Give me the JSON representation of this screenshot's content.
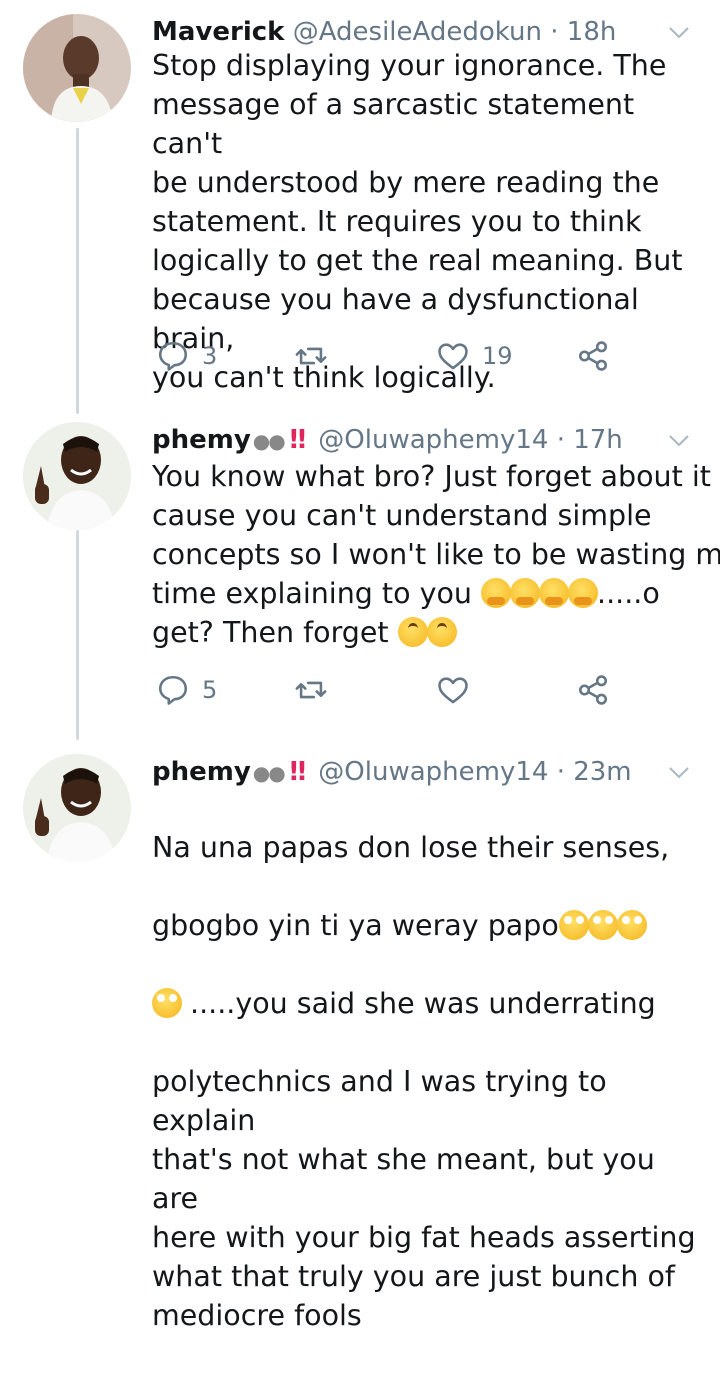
{
  "colors": {
    "text": "#14171a",
    "muted": "#657786",
    "accent_bang": "#e0245e",
    "thread_line": "#cfd9de"
  },
  "tweets": [
    {
      "display_name": "Maverick",
      "handle": "@AdesileAdedokun",
      "time": "18h",
      "text": "Stop displaying your ignorance. The\nmessage of a sarcastic statement can't\nbe understood by mere reading the\nstatement. It requires you to think\nlogically to get the real meaning. But\nbecause you have a dysfunctional brain,\nyou can't think logically.",
      "replies": "3",
      "likes": "19"
    },
    {
      "display_name": "phemy",
      "handle": "@Oluwaphemy14",
      "time": "17h",
      "text_line1": "You know what bro? Just forget about it",
      "text_line2": "cause you can't understand simple",
      "text_line3": "concepts so I won't like to be wasting my",
      "text_line4_a": "time explaining to you ",
      "text_line4_b": ".....o",
      "text_line5": "get? Then forget ",
      "replies": "5",
      "likes": ""
    },
    {
      "display_name": "phemy",
      "handle": "@Oluwaphemy14",
      "time": "23m",
      "text_line1": "Na una papas don lose their senses,",
      "text_line2": "gbogbo yin ti ya weray papo",
      "text_line3_b": " .....you said she was underrating",
      "text_rest": "polytechnics and I was trying to explain\nthat's not what she meant, but you are\nhere with your big fat heads asserting\nwhat that truly you are just bunch of\nmediocre fools"
    }
  ],
  "icons": {
    "reply": "reply-icon",
    "retweet": "retweet-icon",
    "like": "heart-icon",
    "share": "share-icon",
    "menu": "chevron-down-icon"
  }
}
